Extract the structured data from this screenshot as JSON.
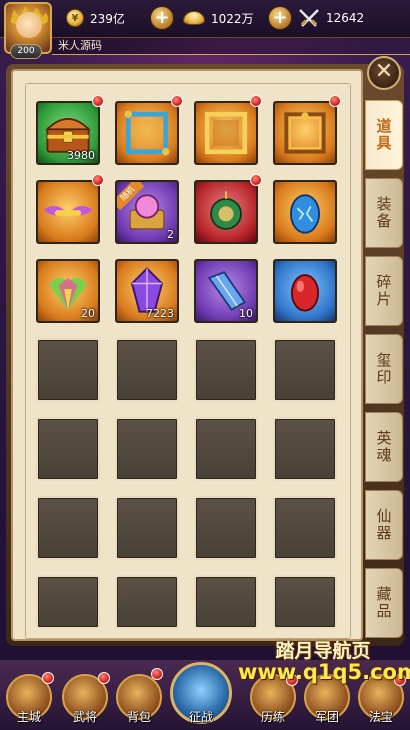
{
  "top_bar": {
    "level": "200",
    "player_name": "米人源码",
    "resources": [
      {
        "icon": "coin-icon",
        "value": "239亿"
      },
      {
        "icon": "gold-ingot-icon",
        "value": "1022万"
      },
      {
        "icon": "crossed-swords-icon",
        "value": "12642"
      }
    ],
    "plus_label": "+"
  },
  "close_label": "✕",
  "tabs": [
    {
      "label": "道具",
      "active": true
    },
    {
      "label": "装备",
      "active": false
    },
    {
      "label": "碎片",
      "active": false
    },
    {
      "label": "玺印",
      "active": false
    },
    {
      "label": "英魂",
      "active": false
    },
    {
      "label": "仙器",
      "active": false
    },
    {
      "label": "藏品",
      "active": false
    }
  ],
  "items": [
    {
      "icon": "treasure-chest-icon",
      "rarity": "green",
      "count": "3980",
      "badge": true
    },
    {
      "icon": "blue-frame-icon",
      "rarity": "orange",
      "count": "",
      "badge": true
    },
    {
      "icon": "gold-frame-icon",
      "rarity": "orange",
      "count": "",
      "badge": true
    },
    {
      "icon": "ornate-frame-icon",
      "rarity": "orange",
      "count": "",
      "badge": true
    },
    {
      "icon": "winged-title-icon",
      "rarity": "orange",
      "count": "",
      "badge": true
    },
    {
      "icon": "random-gift-icon",
      "rarity": "purple",
      "count": "2",
      "badge": false,
      "ribbon": "随机"
    },
    {
      "icon": "red-pouch-icon",
      "rarity": "red",
      "count": "",
      "badge": true
    },
    {
      "icon": "blue-egg-icon",
      "rarity": "orange",
      "count": "",
      "badge": false
    },
    {
      "icon": "rainbow-gem-icon",
      "rarity": "orange",
      "count": "20",
      "badge": false
    },
    {
      "icon": "purple-crystal-icon",
      "rarity": "orange",
      "count": "7223",
      "badge": false
    },
    {
      "icon": "blue-crystal-icon",
      "rarity": "purple",
      "count": "10",
      "badge": false
    },
    {
      "icon": "red-stone-icon",
      "rarity": "blue",
      "count": "",
      "badge": false
    }
  ],
  "empty_slots": 16,
  "bottom_nav": [
    {
      "label": "主城",
      "badge": true
    },
    {
      "label": "武将",
      "badge": true
    },
    {
      "label": "背包",
      "badge": true
    },
    {
      "label": "征战",
      "badge": false
    },
    {
      "label": "历练",
      "badge": true
    },
    {
      "label": "军团",
      "badge": false
    },
    {
      "label": "法宝",
      "badge": true
    }
  ],
  "watermark": {
    "title": "踏月导航页",
    "url": "www.q1q5.com"
  },
  "colors": {
    "active_tab": "#c36a18",
    "panel_bg": "#efe4c8",
    "badge": "#d61818"
  }
}
